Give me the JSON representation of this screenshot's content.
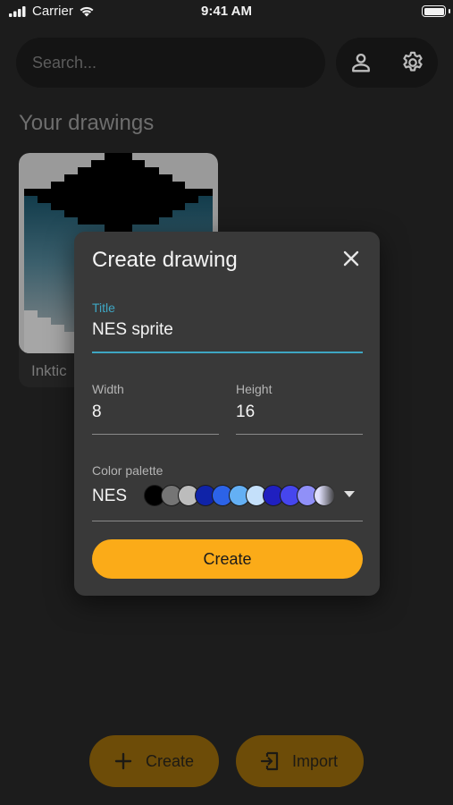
{
  "status_bar": {
    "carrier": "Carrier",
    "time": "9:41 AM"
  },
  "search": {
    "placeholder": "Search..."
  },
  "header_icons": {
    "profile": "person-icon",
    "settings": "gear-icon"
  },
  "section": {
    "title": "Your drawings"
  },
  "drawings": [
    {
      "name": "Inktic"
    }
  ],
  "dialog": {
    "title": "Create drawing",
    "title_field": {
      "label": "Title",
      "value": "NES sprite"
    },
    "width_field": {
      "label": "Width",
      "value": "8"
    },
    "height_field": {
      "label": "Height",
      "value": "16"
    },
    "palette_field": {
      "label": "Color palette",
      "value": "NES",
      "colors": [
        "#000000",
        "#757575",
        "#bcbcbc",
        "#0f23a8",
        "#2c63e8",
        "#64b0f4",
        "#c4e0fa",
        "#1f1fc0",
        "#4646ee",
        "#9090f8",
        "#e0e0fc"
      ]
    },
    "create_label": "Create"
  },
  "bottom_bar": {
    "create_label": "Create",
    "import_label": "Import"
  },
  "colors": {
    "accent": "#fbab18",
    "field_focus": "#3ea6c3",
    "background": "#1c1c1c",
    "dialog": "#393939"
  }
}
